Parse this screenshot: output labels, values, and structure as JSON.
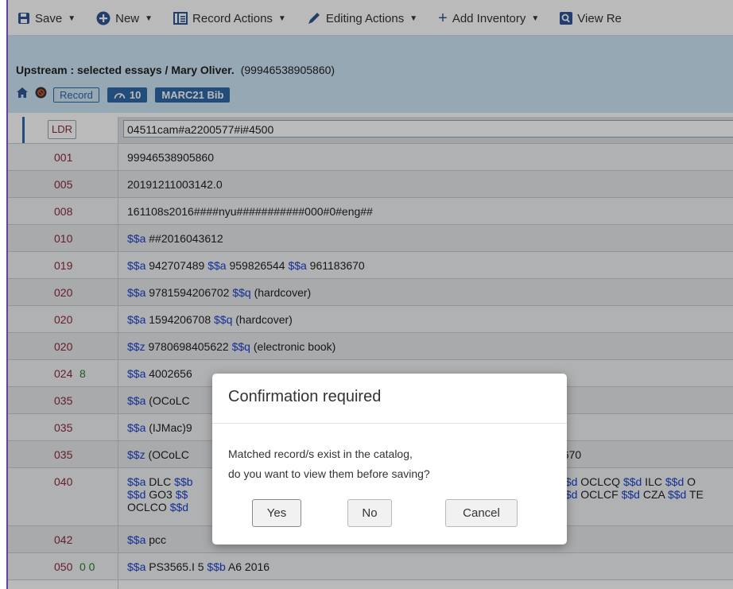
{
  "toolbar": {
    "save": "Save",
    "new": "New",
    "record_actions": "Record Actions",
    "editing_actions": "Editing Actions",
    "add_inventory": "Add Inventory",
    "view": "View Re"
  },
  "record": {
    "title": "Upstream : selected essays / Mary Oliver.",
    "mms_id": "(99946538905860)",
    "record_label": "Record",
    "count": "10",
    "format": "MARC21 Bib"
  },
  "ldr": {
    "tag": "LDR",
    "value": "04511cam#a2200577#i#4500"
  },
  "fields": [
    {
      "tag": "001",
      "ind": "",
      "parts": [
        [
          "t",
          "99946538905860"
        ]
      ]
    },
    {
      "tag": "005",
      "ind": "",
      "parts": [
        [
          "t",
          "20191211003142.0"
        ]
      ]
    },
    {
      "tag": "008",
      "ind": "",
      "parts": [
        [
          "t",
          "161108s2016####nyu###########000#0#eng##"
        ]
      ]
    },
    {
      "tag": "010",
      "ind": "",
      "parts": [
        [
          "s",
          "$$a"
        ],
        [
          "t",
          " ##2016043612"
        ]
      ]
    },
    {
      "tag": "019",
      "ind": "",
      "parts": [
        [
          "s",
          "$$a"
        ],
        [
          "t",
          " 942707489 "
        ],
        [
          "s",
          "$$a"
        ],
        [
          "t",
          " 959826544 "
        ],
        [
          "s",
          "$$a"
        ],
        [
          "t",
          " 961183670"
        ]
      ]
    },
    {
      "tag": "020",
      "ind": "",
      "parts": [
        [
          "s",
          "$$a"
        ],
        [
          "t",
          " 9781594206702 "
        ],
        [
          "s",
          "$$q"
        ],
        [
          "t",
          " (hardcover)"
        ]
      ]
    },
    {
      "tag": "020",
      "ind": "",
      "parts": [
        [
          "s",
          "$$a"
        ],
        [
          "t",
          " 1594206708 "
        ],
        [
          "s",
          "$$q"
        ],
        [
          "t",
          " (hardcover)"
        ]
      ]
    },
    {
      "tag": "020",
      "ind": "",
      "parts": [
        [
          "s",
          "$$z"
        ],
        [
          "t",
          " 9780698405622 "
        ],
        [
          "s",
          "$$q"
        ],
        [
          "t",
          " (electronic book)"
        ]
      ]
    },
    {
      "tag": "024",
      "ind": "8",
      "parts": [
        [
          "s",
          "$$a"
        ],
        [
          "t",
          " 4002656"
        ]
      ]
    },
    {
      "tag": "035",
      "ind": "",
      "parts": [
        [
          "s",
          "$$a"
        ],
        [
          "t",
          " (OCoLC"
        ]
      ]
    },
    {
      "tag": "035",
      "ind": "",
      "parts": [
        [
          "s",
          "$$a"
        ],
        [
          "t",
          " (IJMac)9"
        ]
      ]
    },
    {
      "tag": "035",
      "ind": "",
      "parts": [
        [
          "s",
          "$$z"
        ],
        [
          "t",
          " (OCoLC"
        ]
      ],
      "tail": "3670"
    },
    {
      "tag": "040",
      "ind": "",
      "tall": true,
      "lines": [
        [
          [
            "s",
            "$$a"
          ],
          [
            "t",
            " DLC "
          ],
          [
            "s",
            "$$b"
          ]
        ],
        [
          [
            "s",
            "$$d"
          ],
          [
            "t",
            " GO3 "
          ],
          [
            "s",
            "$$"
          ]
        ],
        [
          [
            "t",
            "OCLCO "
          ],
          [
            "s",
            "$$d"
          ]
        ]
      ],
      "tail_lines": [
        [
          [
            "s",
            "$$d"
          ],
          [
            "t",
            " OCLCQ "
          ],
          [
            "s",
            "$$d"
          ],
          [
            "t",
            " ILC "
          ],
          [
            "s",
            "$$d"
          ],
          [
            "t",
            " O"
          ]
        ],
        [
          [
            "s",
            "$$d"
          ],
          [
            "t",
            " OCLCF "
          ],
          [
            "s",
            "$$d"
          ],
          [
            "t",
            " CZA "
          ],
          [
            "s",
            "$$d"
          ],
          [
            "t",
            " TE"
          ]
        ]
      ]
    },
    {
      "tag": "042",
      "ind": "",
      "parts": [
        [
          "s",
          "$$a"
        ],
        [
          "t",
          " pcc"
        ]
      ]
    },
    {
      "tag": "050",
      "ind": "0  0",
      "parts": [
        [
          "s",
          "$$a"
        ],
        [
          "t",
          " PS3565.I 5 "
        ],
        [
          "s",
          "$$b"
        ],
        [
          "t",
          " A6 2016"
        ]
      ]
    }
  ],
  "dialog": {
    "title": "Confirmation required",
    "line1": "Matched record/s exist in the catalog,",
    "line2": "do you want to view them before saving?",
    "yes": "Yes",
    "no": "No",
    "cancel": "Cancel"
  }
}
